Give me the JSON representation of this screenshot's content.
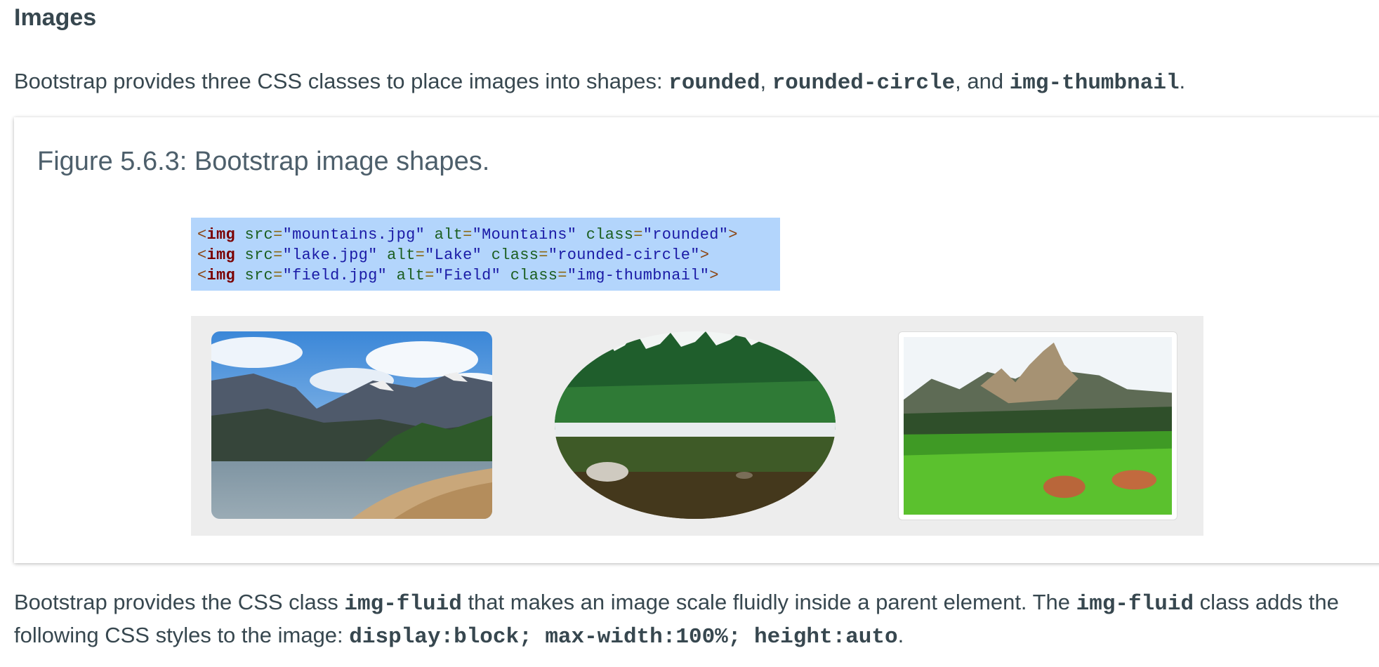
{
  "section": {
    "title": "Images"
  },
  "intro": {
    "text1": "Bootstrap provides three CSS classes to place images into shapes: ",
    "code1": "rounded",
    "sep1": ", ",
    "code2": "rounded-circle",
    "sep2": ", and ",
    "code3": "img-thumbnail",
    "end": "."
  },
  "figure": {
    "caption": "Figure 5.6.3: Bootstrap image shapes.",
    "code_lines": [
      {
        "tag": "img",
        "src": "mountains.jpg",
        "alt": "Mountains",
        "class": "rounded"
      },
      {
        "tag": "img",
        "src": "lake.jpg",
        "alt": "Lake",
        "class": "rounded-circle"
      },
      {
        "tag": "img",
        "src": "field.jpg",
        "alt": "Field",
        "class": "img-thumbnail"
      }
    ],
    "syntax": {
      "lt": "<",
      "gt": ">",
      "eq": "=",
      "q": "\"",
      "attr_src": "src",
      "attr_alt": "alt",
      "attr_class": "class"
    },
    "images": [
      {
        "name": "mountains-image",
        "alt": "Mountains",
        "shape": "rounded"
      },
      {
        "name": "lake-image",
        "alt": "Lake",
        "shape": "rounded-circle"
      },
      {
        "name": "field-image",
        "alt": "Field",
        "shape": "img-thumbnail"
      }
    ]
  },
  "fluid": {
    "text1": "Bootstrap provides the CSS class ",
    "code1": "img-fluid",
    "text2": " that makes an image scale fluidly inside a parent element. The ",
    "code2": "img-fluid",
    "text3": " class adds the following CSS styles to the image: ",
    "code3": "display:block; max-width:100%; height:auto",
    "end": "."
  },
  "colors": {
    "text": "#37474f",
    "code_bg": "#b3d5fc",
    "panel_bg": "#ededed",
    "tag": "#7b0000",
    "attr": "#1b5e20",
    "string": "#1a1aa6"
  }
}
